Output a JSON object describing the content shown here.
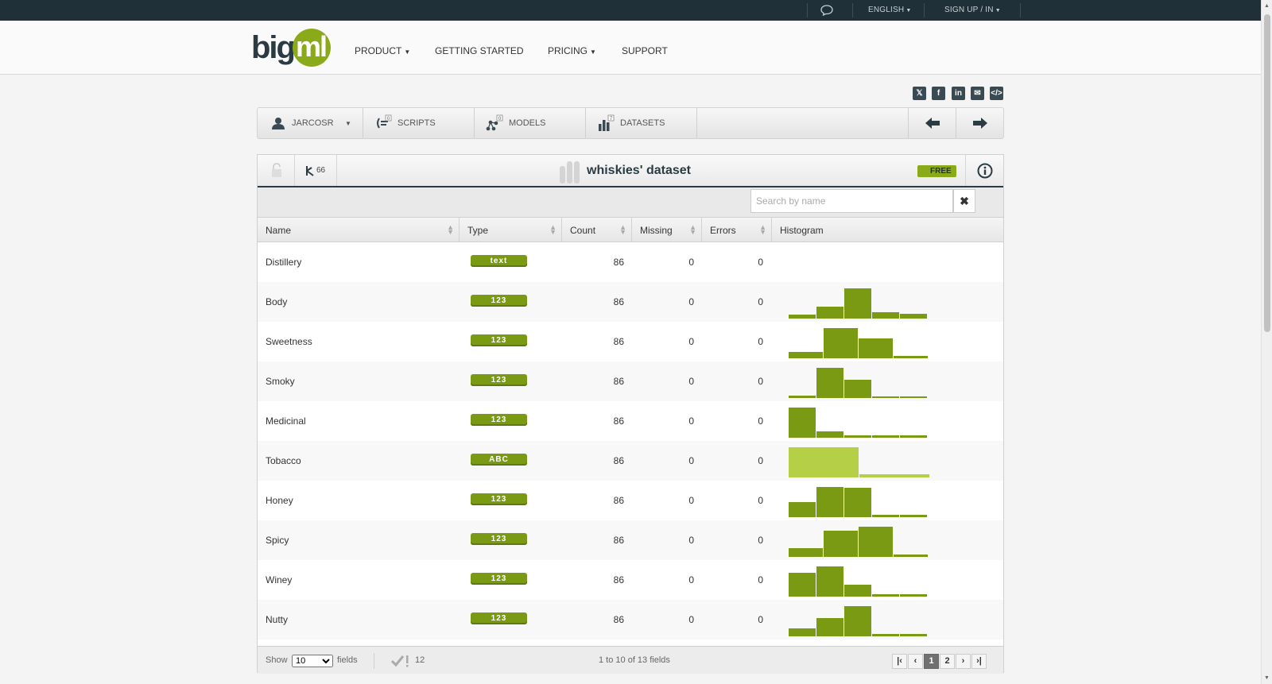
{
  "topbar": {
    "language": "ENGLISH",
    "signin": "SIGN UP / IN"
  },
  "header": {
    "logo_big": "big",
    "logo_ml": "ml",
    "nav": [
      {
        "label": "PRODUCT",
        "dropdown": true
      },
      {
        "label": "GETTING STARTED",
        "dropdown": false
      },
      {
        "label": "PRICING",
        "dropdown": true
      },
      {
        "label": "SUPPORT",
        "dropdown": false
      }
    ]
  },
  "share_icons": [
    "x-icon",
    "facebook-icon",
    "linkedin-icon",
    "email-icon",
    "embed-icon"
  ],
  "breadcrumbs": {
    "user": "JARCOSR",
    "scripts": "SCRIPTS",
    "scripts_count": "0",
    "models": "MODELS",
    "models_count": "0",
    "datasets": "DATASETS",
    "datasets_count": "7"
  },
  "dataset": {
    "title": "whiskies' dataset",
    "instances": "66",
    "badge": "FREE",
    "search_placeholder": "Search by name"
  },
  "table": {
    "headers": [
      "Name",
      "Type",
      "Count",
      "Missing",
      "Errors",
      "Histogram"
    ],
    "rows": [
      {
        "name": "Distillery",
        "type": "text",
        "count": "86",
        "missing": "0",
        "errors": "0",
        "hist": [],
        "hist_color": "#7b9a14"
      },
      {
        "name": "Body",
        "type": "123",
        "count": "86",
        "missing": "0",
        "errors": "0",
        "hist": [
          0.12,
          0.4,
          1.0,
          0.22,
          0.16
        ],
        "hist_color": "#7b9a14"
      },
      {
        "name": "Sweetness",
        "type": "123",
        "count": "86",
        "missing": "0",
        "errors": "0",
        "hist": [
          0.2,
          1.0,
          0.65,
          0.08
        ],
        "hist_color": "#7b9a14"
      },
      {
        "name": "Smoky",
        "type": "123",
        "count": "86",
        "missing": "0",
        "errors": "0",
        "hist": [
          0.08,
          1.0,
          0.6,
          0.06,
          0.06
        ],
        "hist_color": "#7b9a14"
      },
      {
        "name": "Medicinal",
        "type": "123",
        "count": "86",
        "missing": "0",
        "errors": "0",
        "hist": [
          1.0,
          0.22,
          0.08,
          0.08,
          0.08
        ],
        "hist_color": "#7b9a14"
      },
      {
        "name": "Tobacco",
        "type": "ABC",
        "count": "86",
        "missing": "0",
        "errors": "0",
        "hist": [
          1.0,
          0.1
        ],
        "hist_color": "#b5cf47"
      },
      {
        "name": "Honey",
        "type": "123",
        "count": "86",
        "missing": "0",
        "errors": "0",
        "hist": [
          0.5,
          1.0,
          0.97,
          0.08,
          0.08
        ],
        "hist_color": "#7b9a14"
      },
      {
        "name": "Spicy",
        "type": "123",
        "count": "86",
        "missing": "0",
        "errors": "0",
        "hist": [
          0.28,
          0.88,
          1.0,
          0.08
        ],
        "hist_color": "#7b9a14"
      },
      {
        "name": "Winey",
        "type": "123",
        "count": "86",
        "missing": "0",
        "errors": "0",
        "hist": [
          0.78,
          1.0,
          0.4,
          0.08,
          0.08
        ],
        "hist_color": "#7b9a14"
      },
      {
        "name": "Nutty",
        "type": "123",
        "count": "86",
        "missing": "0",
        "errors": "0",
        "hist": [
          0.25,
          0.6,
          1.0,
          0.08,
          0.08
        ],
        "hist_color": "#7b9a14"
      }
    ]
  },
  "footer": {
    "show_label": "Show",
    "show_value": "10",
    "fields_label": "fields",
    "valid_count": "12",
    "range_text": "1 to 10 of 13 fields",
    "pages": [
      "1",
      "2"
    ],
    "current_page": "1"
  }
}
